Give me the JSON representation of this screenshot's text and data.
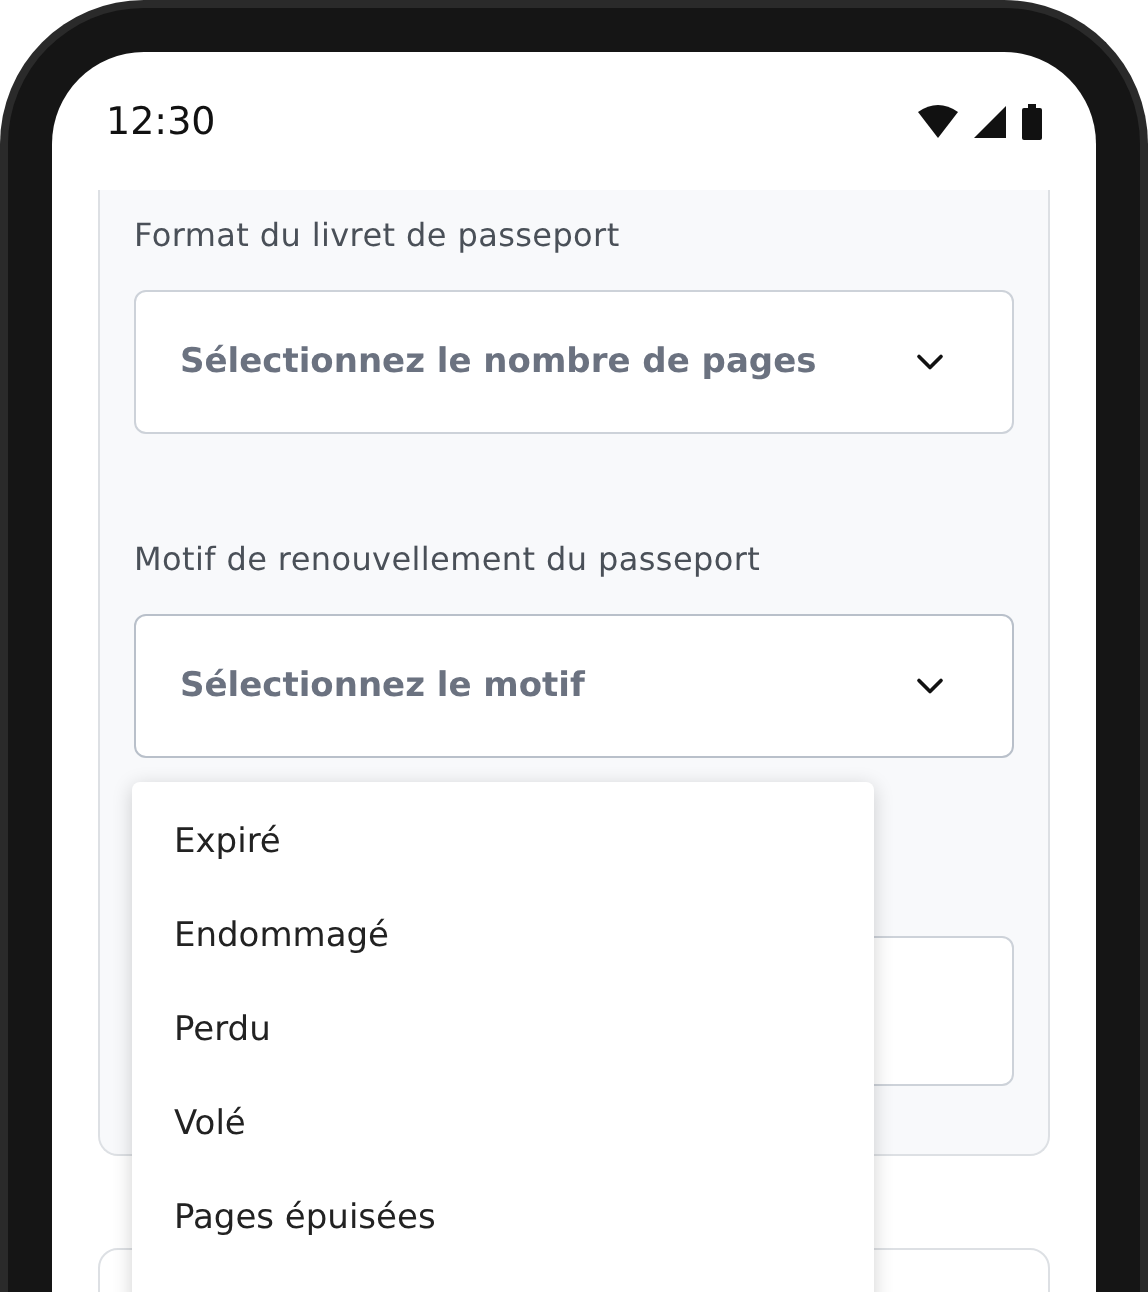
{
  "status_bar": {
    "time": "12:30"
  },
  "form": {
    "fields": [
      {
        "label": "Format du livret de passeport",
        "placeholder": "Sélectionnez le nombre de pages",
        "expanded": false
      },
      {
        "label": "Motif de renouvellement du passeport",
        "placeholder": "Sélectionnez le motif",
        "expanded": true
      }
    ]
  },
  "dropdown": {
    "options": [
      {
        "label": "Expiré"
      },
      {
        "label": "Endommagé"
      },
      {
        "label": "Perdu"
      },
      {
        "label": "Volé"
      },
      {
        "label": "Pages épuisées"
      }
    ]
  }
}
